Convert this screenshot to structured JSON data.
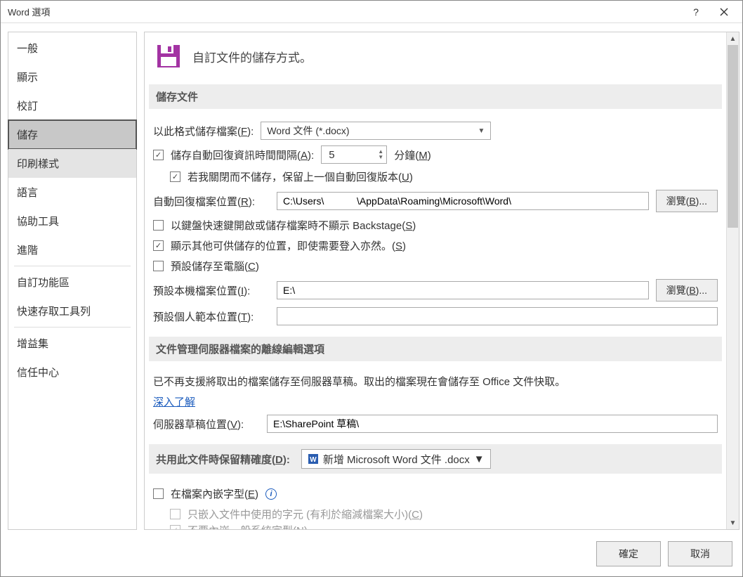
{
  "window": {
    "title": "Word 選項"
  },
  "sidebar": {
    "items": [
      {
        "label": "一般"
      },
      {
        "label": "顯示"
      },
      {
        "label": "校訂"
      },
      {
        "label": "儲存",
        "selected": true
      },
      {
        "label": "印刷樣式",
        "hover": true
      },
      {
        "label": "語言"
      },
      {
        "label": "協助工具"
      },
      {
        "label": "進階"
      }
    ],
    "items2": [
      {
        "label": "自訂功能區"
      },
      {
        "label": "快速存取工具列"
      }
    ],
    "items3": [
      {
        "label": "增益集"
      },
      {
        "label": "信任中心"
      }
    ]
  },
  "header": {
    "text": "自訂文件的儲存方式。"
  },
  "section1": {
    "title": "儲存文件",
    "format_label": "以此格式儲存檔案(",
    "format_key": "F",
    "format_label2": "):",
    "format_value": "Word 文件 (*.docx)",
    "autorecover_label": "儲存自動回復資訊時間間隔(",
    "autorecover_key": "A",
    "autorecover_label2": "):",
    "autorecover_value": "5",
    "minutes_label": "分鐘(",
    "minutes_key": "M",
    "minutes_label2": ")",
    "keep_last_label": "若我關閉而不儲存，保留上一個自動回復版本(",
    "keep_last_key": "U",
    "keep_last_label2": ")",
    "recover_loc_label": "自動回復檔案位置(",
    "recover_loc_key": "R",
    "recover_loc_label2": "):",
    "recover_loc_value": "C:\\Users\\            \\AppData\\Roaming\\Microsoft\\Word\\",
    "browse_label": "瀏覽(",
    "browse_key": "B",
    "browse_label2": ")...",
    "no_backstage_label": "以鍵盤快速鍵開啟或儲存檔案時不顯示 Backstage(",
    "no_backstage_key": "S",
    "no_backstage_label2": ")",
    "show_other_label": "顯示其他可供儲存的位置，即使需要登入亦然。(",
    "show_other_key": "S",
    "show_other_label2": ")",
    "default_pc_label": "預設儲存至電腦(",
    "default_pc_key": "C",
    "default_pc_label2": ")",
    "default_loc_label": "預設本機檔案位置(",
    "default_loc_key": "I",
    "default_loc_label2": "):",
    "default_loc_value": "E:\\",
    "template_loc_label": "預設個人範本位置(",
    "template_loc_key": "T",
    "template_loc_label2": "):",
    "template_loc_value": ""
  },
  "section2": {
    "title": "文件管理伺服器檔案的離線編輯選項",
    "note": "已不再支援將取出的檔案儲存至伺服器草稿。取出的檔案現在會儲存至 Office 文件快取。",
    "learn_more": "深入了解",
    "draft_loc_label": "伺服器草稿位置(",
    "draft_loc_key": "V",
    "draft_loc_label2": "):",
    "draft_loc_value": "E:\\SharePoint 草稿\\"
  },
  "section3": {
    "title_a": "共用此文件時保留精確度(",
    "title_key": "D",
    "title_b": "):",
    "doc_value": "新增 Microsoft Word 文件 .docx",
    "embed_label": "在檔案內嵌字型(",
    "embed_key": "E",
    "embed_label2": ")",
    "embed_sub1_a": "只嵌入文件中使用的字元 (有利於縮減檔案大小)(",
    "embed_sub1_key": "C",
    "embed_sub1_b": ")",
    "embed_sub2_a": "不要內嵌一般系統字型(",
    "embed_sub2_key": "N",
    "embed_sub2_b": ")"
  },
  "footer": {
    "ok": "確定",
    "cancel": "取消"
  }
}
